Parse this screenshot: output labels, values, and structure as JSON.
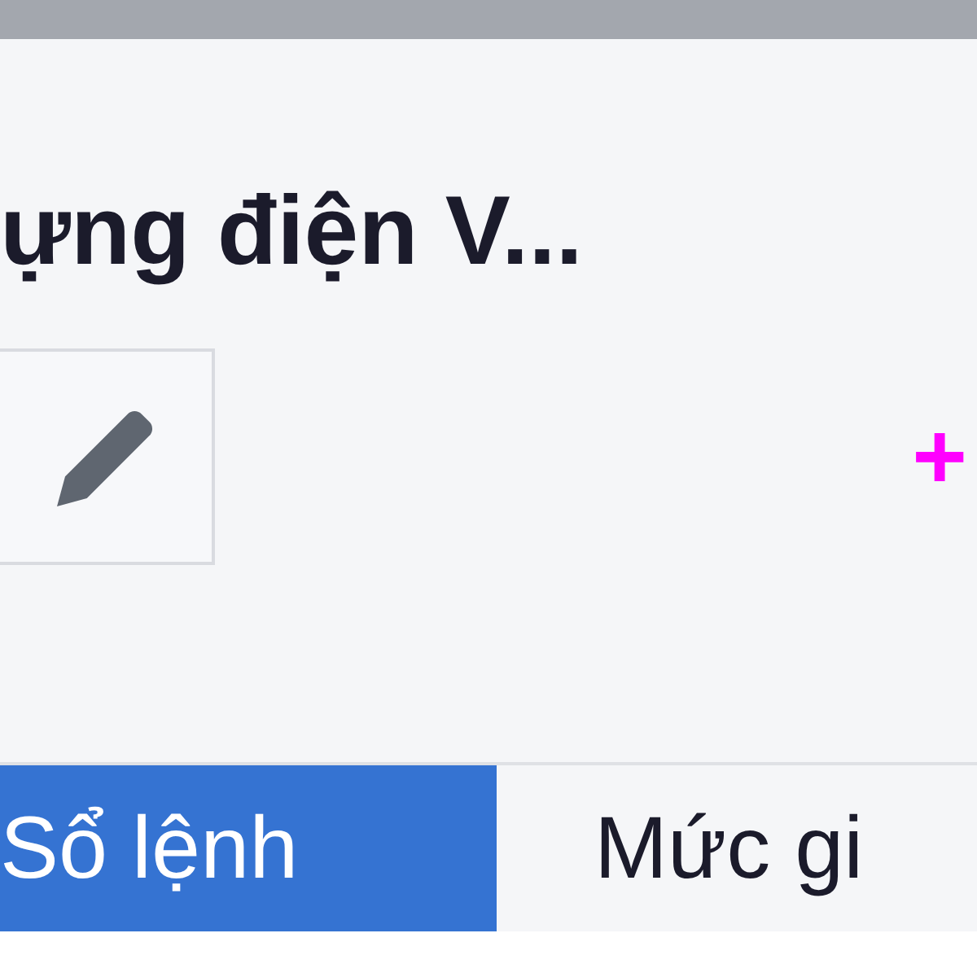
{
  "title": "ựng điện V...",
  "change": "+",
  "tabs": [
    {
      "label": "Sổ lệnh",
      "selected": true
    },
    {
      "label": "Mức gi",
      "selected": false
    }
  ]
}
